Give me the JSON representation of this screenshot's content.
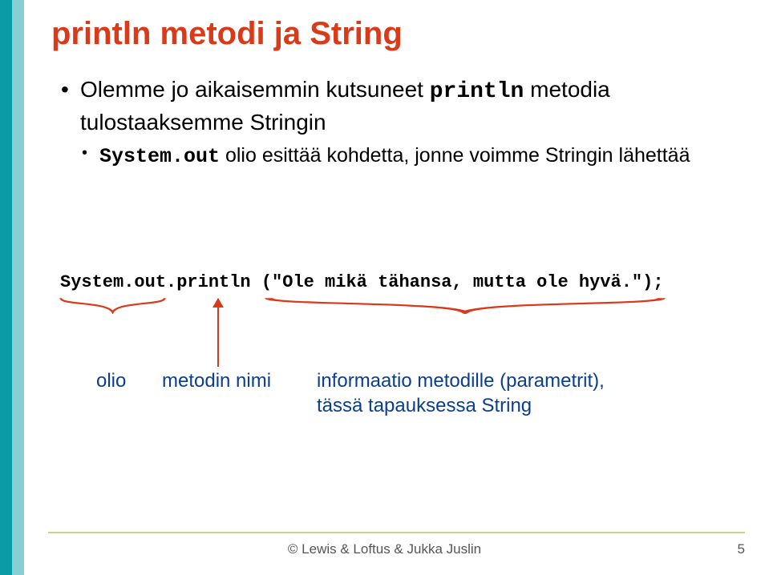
{
  "title": "println metodi ja String",
  "bullets": {
    "item1_pre": "Olemme jo aikaisemmin kutsuneet ",
    "item1_code": "println",
    "item1_post": " metodia tulostaaksemme Stringin",
    "item2_code": "System.out",
    "item2_post": " olio esittää kohdetta, jonne voimme Stringin lähettää"
  },
  "code": "System.out.println (\"Ole mikä tähansa, mutta ole hyvä.\");",
  "labels": {
    "olio": "olio",
    "metodin_nimi": "metodin nimi",
    "informaatio_line1": "informaatio metodille (parametrit),",
    "informaatio_line2": "tässä tapauksessa String"
  },
  "footer": {
    "copyright": "© Lewis & Loftus & Jukka Juslin",
    "page": "5"
  }
}
